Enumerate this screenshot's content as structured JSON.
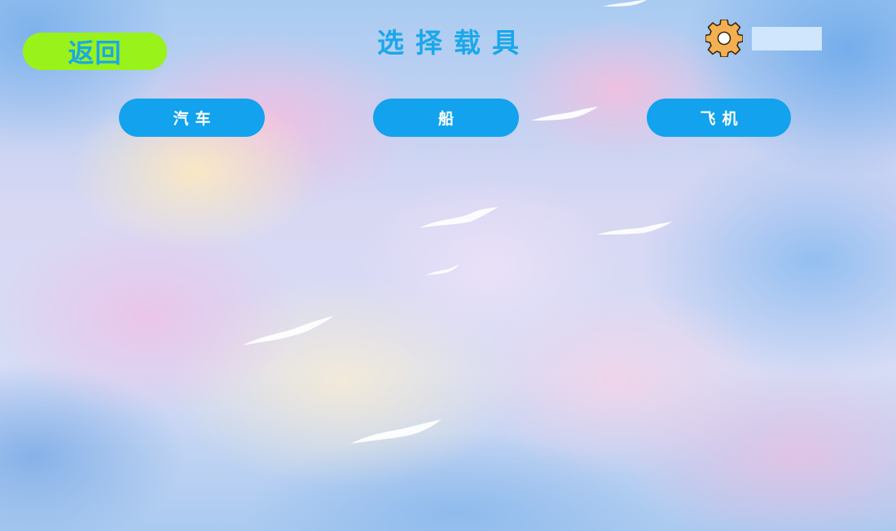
{
  "header": {
    "back_label": "返回",
    "title": "选择载具"
  },
  "vehicles": [
    {
      "label": "汽车"
    },
    {
      "label": "船"
    },
    {
      "label": "飞机"
    }
  ],
  "icons": {
    "settings": "gear-icon"
  },
  "colors": {
    "back_button_bg": "#99f21a",
    "accent_blue": "#1aa8ea",
    "vehicle_button_bg": "#12a2ee",
    "gear_fill": "#f3b052"
  }
}
